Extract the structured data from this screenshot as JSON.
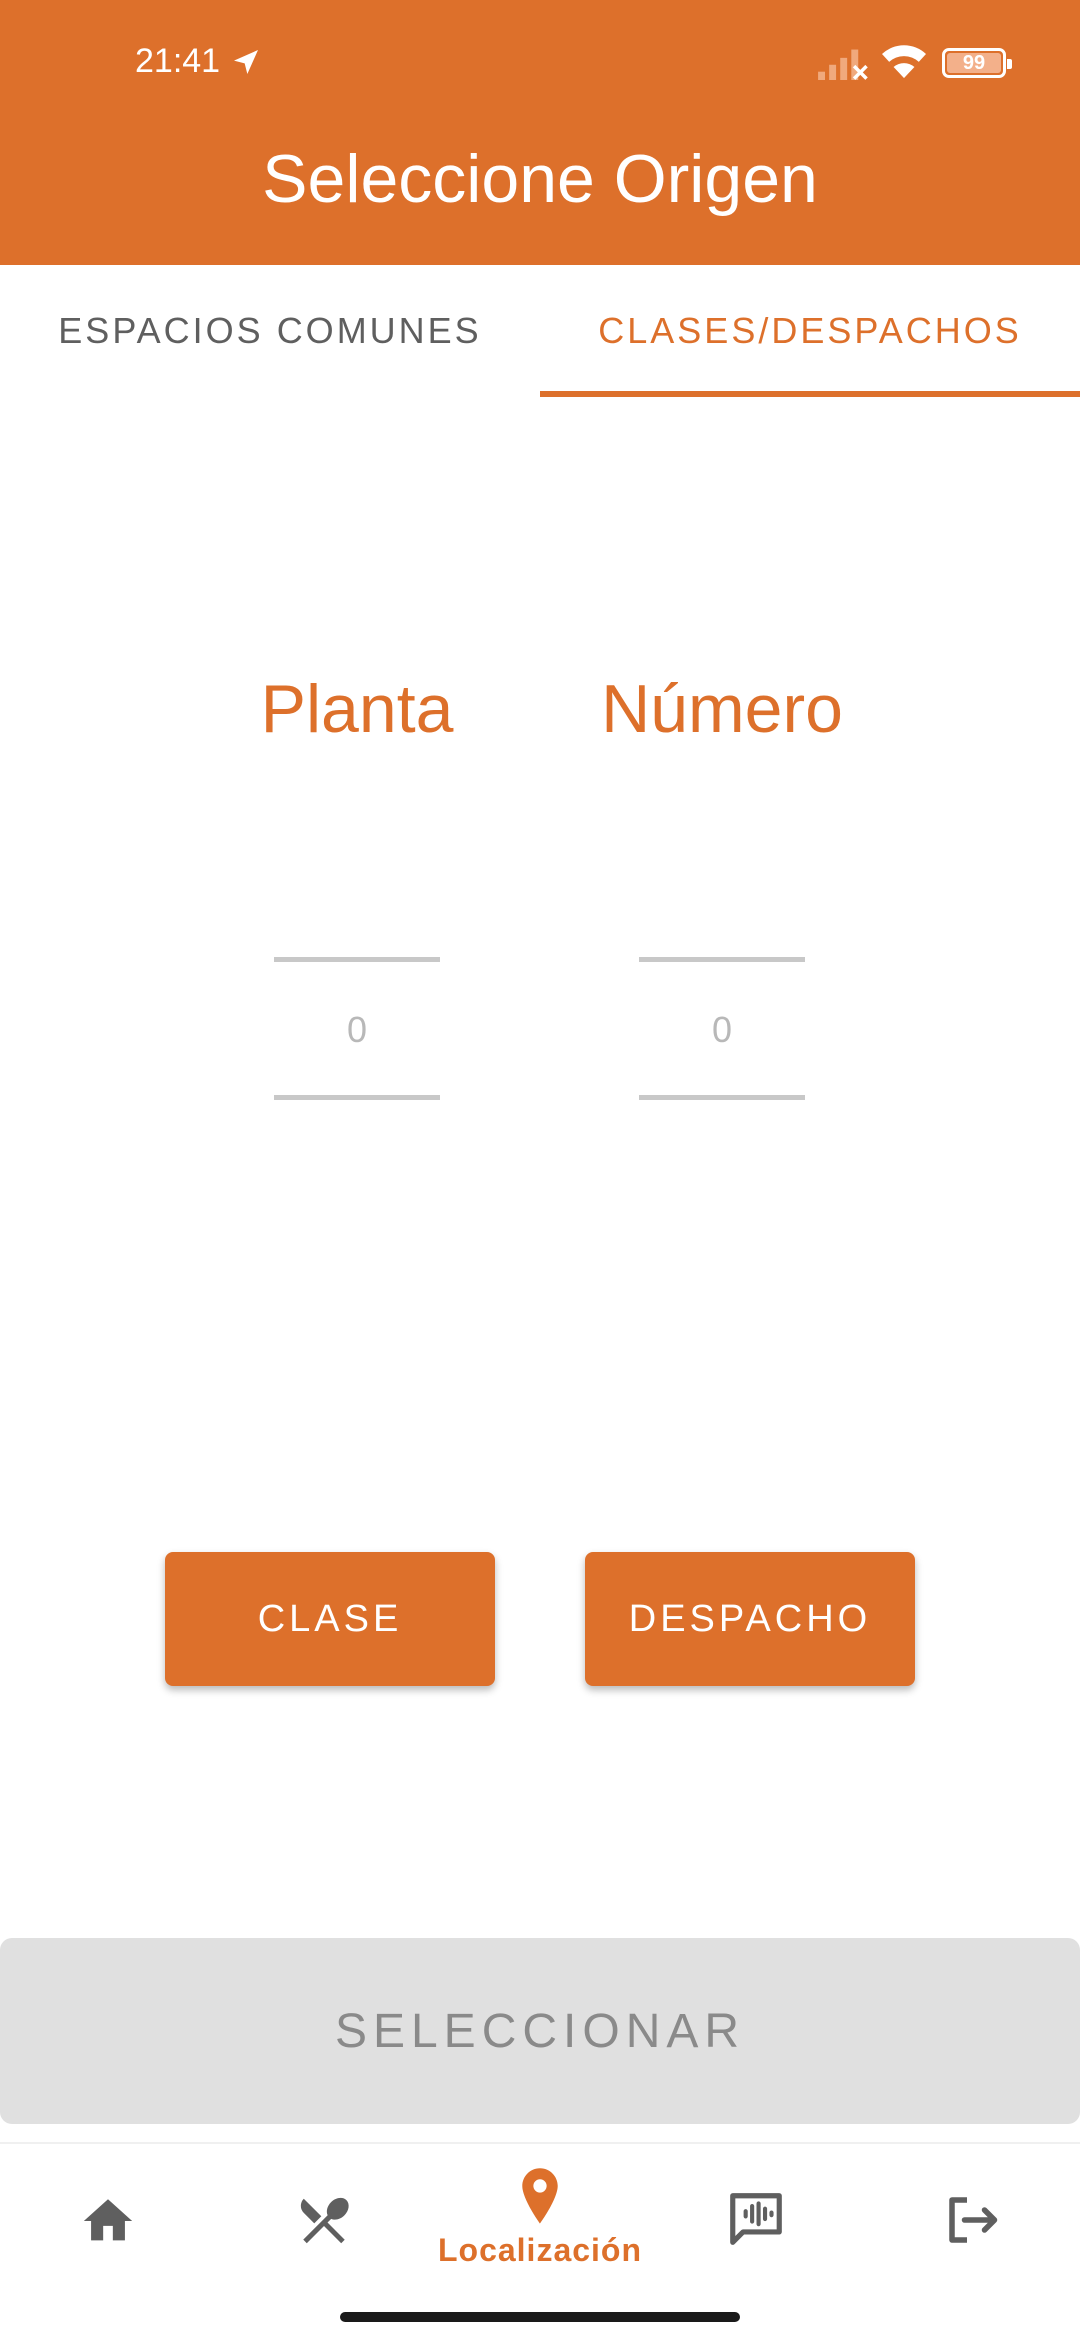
{
  "colors": {
    "accent": "#DD702B",
    "disabled_bg": "#E0E0E0",
    "disabled_text": "#8a8a8a",
    "inactive_text": "#5f5f5f",
    "inactive_icon": "#5f5f5f"
  },
  "status_bar": {
    "time": "21:41",
    "battery": "99",
    "icons": [
      "navigation-icon",
      "signal-icon",
      "wifi-icon",
      "battery-icon"
    ]
  },
  "header": {
    "title": "Seleccione Origen"
  },
  "tabs": [
    {
      "label": "ESPACIOS COMUNES",
      "active": false
    },
    {
      "label": "CLASES/DESPACHOS",
      "active": true
    }
  ],
  "fields": {
    "planta": {
      "label": "Planta",
      "value": "",
      "placeholder": "0"
    },
    "numero": {
      "label": "Número",
      "value": "",
      "placeholder": "0"
    }
  },
  "buttons": {
    "clase": "CLASE",
    "despacho": "DESPACHO",
    "seleccionar": "SELECCIONAR"
  },
  "bottom_nav": {
    "items": [
      {
        "icon": "home-icon",
        "label": "",
        "active": false
      },
      {
        "icon": "restaurant-icon",
        "label": "",
        "active": false
      },
      {
        "icon": "location-icon",
        "label": "Localización",
        "active": true
      },
      {
        "icon": "voice-chat-icon",
        "label": "",
        "active": false
      },
      {
        "icon": "logout-icon",
        "label": "",
        "active": false
      }
    ]
  }
}
